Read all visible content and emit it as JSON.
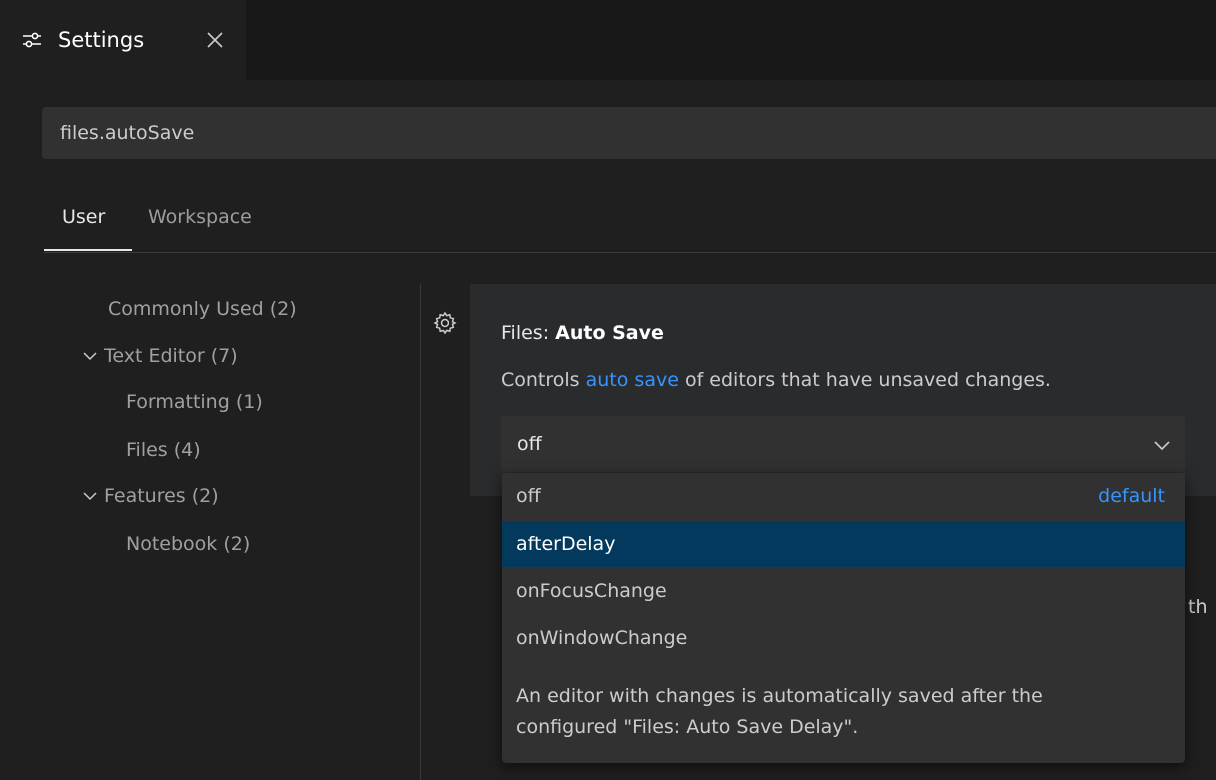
{
  "tab": {
    "label": "Settings",
    "icon": "settings-sliders-icon",
    "close_icon": "close-icon"
  },
  "search": {
    "value": "files.autoSave"
  },
  "scopes": {
    "user": "User",
    "workspace": "Workspace"
  },
  "toc": {
    "items": [
      {
        "label": "Commonly Used (2)"
      },
      {
        "label": "Text Editor (7)"
      },
      {
        "label": "Formatting (1)"
      },
      {
        "label": "Files (4)"
      },
      {
        "label": "Features (2)"
      },
      {
        "label": "Notebook (2)"
      }
    ]
  },
  "setting": {
    "title_prefix": "Files: ",
    "title_name": "Auto Save",
    "desc_before": "Controls ",
    "desc_link": "auto save",
    "desc_after": " of editors that have unsaved changes.",
    "current_value": "off"
  },
  "dropdown": {
    "options": [
      {
        "label": "off",
        "badge": "default"
      },
      {
        "label": "afterDelay"
      },
      {
        "label": "onFocusChange"
      },
      {
        "label": "onWindowChange"
      }
    ],
    "description_line1": "An editor with changes is automatically saved after the",
    "description_line2": "configured \"Files: Auto Save Delay\"."
  },
  "behind": {
    "text": "th"
  },
  "colors": {
    "accent_link": "#3794ff",
    "selected_option": "#04395e",
    "background": "#1f1f1f"
  }
}
